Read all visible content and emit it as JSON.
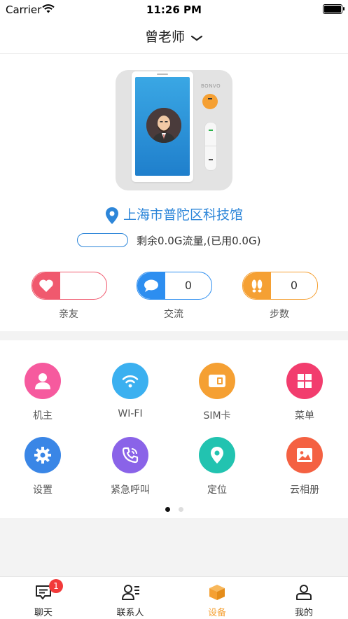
{
  "status_bar": {
    "carrier": "Carrier",
    "time": "11:26 PM"
  },
  "header": {
    "title": "曾老师"
  },
  "device": {
    "brand": "BONVO"
  },
  "location": {
    "text": "上海市普陀区科技馆"
  },
  "data_usage": {
    "text": "剩余0.0G流量,(已用0.0G)"
  },
  "stats": [
    {
      "label": "亲友",
      "value": "",
      "color": "#f0596e",
      "icon": "heart-icon"
    },
    {
      "label": "交流",
      "value": "0",
      "color": "#2d8ef0",
      "icon": "chat-bubble-icon"
    },
    {
      "label": "步数",
      "value": "0",
      "color": "#f5a033",
      "icon": "footprints-icon"
    }
  ],
  "menu": [
    {
      "label": "机主",
      "color": "#f65a9e",
      "icon": "person-icon"
    },
    {
      "label": "WI-FI",
      "color": "#3bb0f0",
      "icon": "wifi-icon"
    },
    {
      "label": "SIM卡",
      "color": "#f5a033",
      "icon": "sim-card-icon"
    },
    {
      "label": "菜单",
      "color": "#f23d6e",
      "icon": "grid-menu-icon"
    },
    {
      "label": "设置",
      "color": "#3a86e6",
      "icon": "gear-icon"
    },
    {
      "label": "紧急呼叫",
      "color": "#8a63e8",
      "icon": "phone-call-icon"
    },
    {
      "label": "定位",
      "color": "#22c3b0",
      "icon": "location-pin-icon"
    },
    {
      "label": "云相册",
      "color": "#f46142",
      "icon": "picture-icon"
    }
  ],
  "pager": {
    "pages": 2,
    "current": 1
  },
  "tabs": [
    {
      "label": "聊天",
      "badge": "1",
      "icon": "chat-icon"
    },
    {
      "label": "联系人",
      "icon": "contacts-icon"
    },
    {
      "label": "设备",
      "icon": "device-box-icon",
      "active": true
    },
    {
      "label": "我的",
      "icon": "profile-icon"
    }
  ],
  "colors": {
    "accent": "#f5a033",
    "link": "#2d86d9"
  }
}
